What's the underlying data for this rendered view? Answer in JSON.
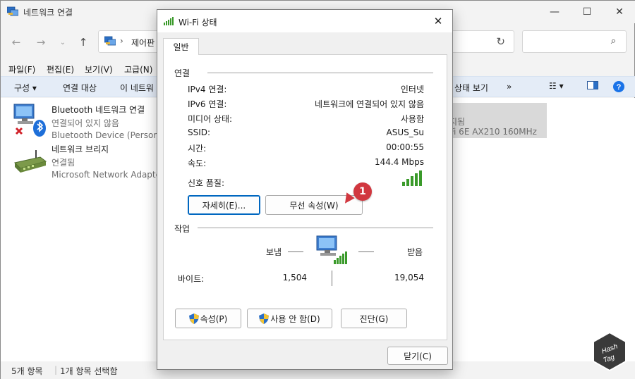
{
  "explorer": {
    "title": "네트워크 연결",
    "address_root": "제어판",
    "menu": [
      "파일(F)",
      "편집(E)",
      "보기(V)",
      "고급(N)"
    ],
    "commands": [
      "구성 ▾",
      "연결 대상",
      "이 네트워"
    ],
    "commands_right": [
      "상태 보기",
      "»"
    ],
    "items": [
      {
        "name": "Bluetooth 네트워크 연결",
        "status": "연결되어 있지 않음",
        "device": "Bluetooth Device (Personal A"
      },
      {
        "name": "네트워크 브리지",
        "status": "연결됨",
        "device": "Microsoft Network Adapter"
      }
    ],
    "selected_item": {
      "status": "지됨",
      "device": "Fi 6E AX210 160MHz"
    },
    "status_count": "5개 항목",
    "status_selected": "1개 항목 선택함"
  },
  "dialog": {
    "title": "Wi-Fi 상태",
    "tab_general": "일반",
    "connection": {
      "heading": "연결",
      "rows": [
        {
          "label": "IPv4 연결:",
          "value": "인터넷"
        },
        {
          "label": "IPv6 연결:",
          "value": "네트워크에 연결되어 있지 않음"
        },
        {
          "label": "미디어 상태:",
          "value": "사용함"
        },
        {
          "label": "SSID:",
          "value": "ASUS_Su"
        },
        {
          "label": "시간:",
          "value": "00:00:55"
        },
        {
          "label": "속도:",
          "value": "144.4 Mbps"
        }
      ],
      "signal_label": "신호 품질:",
      "signal_bars": 5
    },
    "buttons": {
      "details": "자세히(E)...",
      "wireless_props": "무선 속성(W)"
    },
    "activity": {
      "heading": "작업",
      "sent_label": "보냄",
      "received_label": "받음",
      "bytes_label": "바이트:",
      "bytes_sent": "1,504",
      "bytes_received": "19,054"
    },
    "bottom_buttons": {
      "properties": "속성(P)",
      "disable": "사용 안 함(D)",
      "diagnose": "진단(G)"
    },
    "close_button": "닫기(C)"
  },
  "annotation": {
    "badge": "1",
    "color": "#d1373f"
  },
  "logo": {
    "line1": "Hash",
    "line2": "Tag"
  }
}
